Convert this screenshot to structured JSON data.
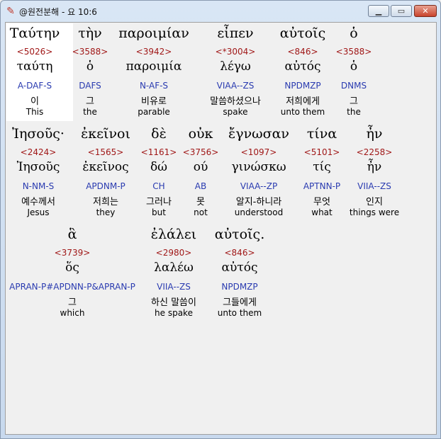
{
  "window": {
    "title": "@원전분해 - 요 10:6",
    "minimize_symbol": "▁",
    "maximize_symbol": "▭",
    "close_symbol": "✕",
    "app_icon": "tool-icon"
  },
  "words": [
    {
      "greek": "Ταύτην",
      "strong": "<5026>",
      "lemma": "ταύτη",
      "parse": "A-DAF-S",
      "korean": "이",
      "english": "This"
    },
    {
      "greek": "τὴν",
      "strong": "<3588>",
      "lemma": "ὁ",
      "parse": "DAFS",
      "korean": "그",
      "english": "the"
    },
    {
      "greek": "παροιμίαν",
      "strong": "<3942>",
      "lemma": "παροιμία",
      "parse": "N-AF-S",
      "korean": "비유로",
      "english": "parable"
    },
    {
      "greek": "εἶπεν",
      "strong": "<*3004>",
      "lemma": "λέγω",
      "parse": "VIAA--ZS",
      "korean": "말씀하셨으나",
      "english": "spake"
    },
    {
      "greek": "αὐτοῖς",
      "strong": "<846>",
      "lemma": "αὐτός",
      "parse": "NPDMZP",
      "korean": "저희에게",
      "english": "unto them"
    },
    {
      "greek": "ὁ",
      "strong": "<3588>",
      "lemma": "ὁ",
      "parse": "DNMS",
      "korean": "그",
      "english": "the"
    },
    {
      "greek": "Ἰησοῦς·",
      "strong": "<2424>",
      "lemma": "Ἰησοῦς",
      "parse": "N-NM-S",
      "korean": "예수께서",
      "english": "Jesus"
    },
    {
      "greek": "ἐκεῖνοι",
      "strong": "<1565>",
      "lemma": "ἐκεῖνος",
      "parse": "APDNM-P",
      "korean": "저희는",
      "english": "they"
    },
    {
      "greek": "δὲ",
      "strong": "<1161>",
      "lemma": "δώ",
      "parse": "CH",
      "korean": "그러나",
      "english": "but"
    },
    {
      "greek": "οὐκ",
      "strong": "<3756>",
      "lemma": "ού",
      "parse": "AB",
      "korean": "못",
      "english": "not"
    },
    {
      "greek": "ἔγνωσαν",
      "strong": "<1097>",
      "lemma": "γινώσκω",
      "parse": "VIAA--ZP",
      "korean": "알지-하니라",
      "english": "understood"
    },
    {
      "greek": "τίνα",
      "strong": "<5101>",
      "lemma": "τίς",
      "parse": "APTNN-P",
      "korean": "무엇",
      "english": "what"
    },
    {
      "greek": "ἦν",
      "strong": "<2258>",
      "lemma": "ἦν",
      "parse": "VIIA--ZS",
      "korean": "인지",
      "english": "things were"
    },
    {
      "greek": "ἃ",
      "strong": "<3739>",
      "lemma": "ὅς",
      "parse": "APRAN-P#APDNN-P&APRAN-P",
      "korean": "그",
      "english": "which"
    },
    {
      "greek": "ἐλάλει",
      "strong": "<2980>",
      "lemma": "λαλέω",
      "parse": "VIIA--ZS",
      "korean": "하신 말씀이",
      "english": "he spake"
    },
    {
      "greek": "αὐτοῖς.",
      "strong": "<846>",
      "lemma": "αὐτός",
      "parse": "NPDMZP",
      "korean": "그들에게",
      "english": "unto them"
    }
  ]
}
